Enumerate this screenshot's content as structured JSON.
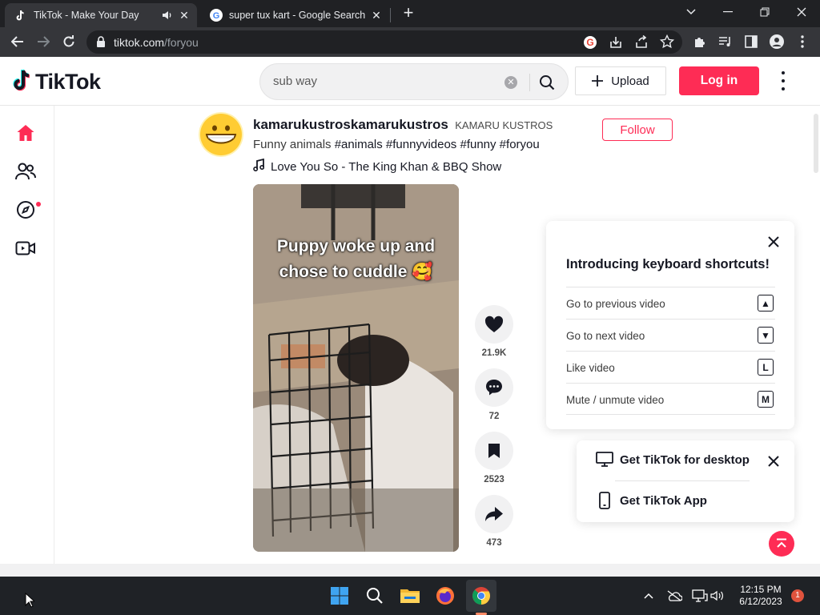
{
  "browser": {
    "tabs": [
      {
        "title": "TikTok - Make Your Day",
        "active": true,
        "favicon": "tiktok-icon",
        "audio": true
      },
      {
        "title": "super tux kart - Google Search",
        "active": false,
        "favicon": "google-icon"
      }
    ],
    "new_tab_label": "+",
    "url_host": "tiktok.com",
    "url_path": "/foryou"
  },
  "header": {
    "logo_text": "TikTok",
    "search_value": "sub way",
    "upload_label": "Upload",
    "login_label": "Log in"
  },
  "sidebar": {
    "items": [
      "home-icon",
      "following-icon",
      "explore-icon",
      "live-icon"
    ]
  },
  "post": {
    "author_name": "kamarukustroskamarukustros",
    "author_nick": "KAMARU KUSTROS",
    "follow_label": "Follow",
    "desc_text": "Funny animals",
    "tags": "#animals #funnyvideos #funny #foryou",
    "music": "Love You So - The King Khan & BBQ Show",
    "video_caption_1": "Puppy woke up and",
    "video_caption_2": "chose to cuddle 🥰",
    "likes": "21.9K",
    "comments": "72",
    "saves": "2523",
    "shares": "473"
  },
  "shortcuts": {
    "title": "Introducing keyboard shortcuts!",
    "rows": [
      {
        "label": "Go to previous video",
        "key": "▲"
      },
      {
        "label": "Go to next video",
        "key": "▼"
      },
      {
        "label": "Like video",
        "key": "L"
      },
      {
        "label": "Mute / unmute video",
        "key": "M"
      }
    ]
  },
  "getapp": {
    "desktop_label": "Get TikTok for desktop",
    "app_label": "Get TikTok App"
  },
  "taskbar": {
    "time": "12:15 PM",
    "date": "6/12/2023",
    "notifications": "1"
  },
  "colors": {
    "brand": "#fe2c55",
    "chrome_dark": "#202124",
    "taskbar": "#1f2226"
  }
}
